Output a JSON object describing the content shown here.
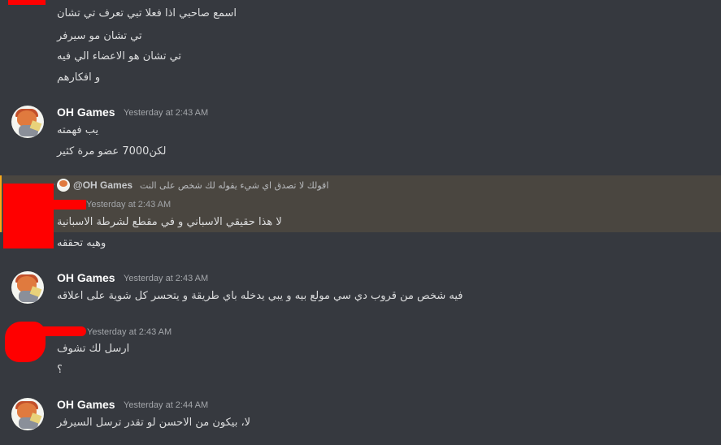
{
  "colors": {
    "background": "#36393f",
    "highlight": "#4a4640",
    "redaction": "#ff0000",
    "username": "#ffffff",
    "timestamp": "#a3a6aa"
  },
  "messages": [
    {
      "lines": [
        "اسمع صاحبي  اذا فعلا تبي تعرف تي تشان",
        "تي تشان مو سيرفر",
        "تي تشان هو الاعضاء الي فيه",
        "و افكارهم"
      ]
    },
    {
      "author": "OH Games",
      "timestamp": "Yesterday at 2:43 AM",
      "avatar_icon": "cartoon-avatar-icon",
      "lines": [
        "يب فهمته",
        "لكن7000 عضو مرة كثير"
      ]
    },
    {
      "reply": {
        "name": "@OH Games",
        "text": "اقولك لا تصدق اي شيء يقوله لك شخص على النت"
      },
      "timestamp": "Yesterday at 2:43 AM",
      "lines": [
        "لا هذا حقيقي الاسباني و في مقطع لشرطة الاسبانية",
        "وهيه تحققه"
      ]
    },
    {
      "author": "OH Games",
      "timestamp": "Yesterday at 2:43 AM",
      "avatar_icon": "cartoon-avatar-icon",
      "lines": [
        "فيه شخص من قروب دي سي مولع بيه و يبي يدخله باي طريقة و يتحسر كل شوية على اعلاقه"
      ]
    },
    {
      "timestamp": "Yesterday at 2:43 AM",
      "lines": [
        "ارسل لك تشوف",
        "؟"
      ]
    },
    {
      "author": "OH Games",
      "timestamp": "Yesterday at 2:44 AM",
      "avatar_icon": "cartoon-avatar-icon",
      "lines": [
        "لا، بيكون من الاحسن لو تقدر ترسل السيرفر"
      ]
    }
  ]
}
